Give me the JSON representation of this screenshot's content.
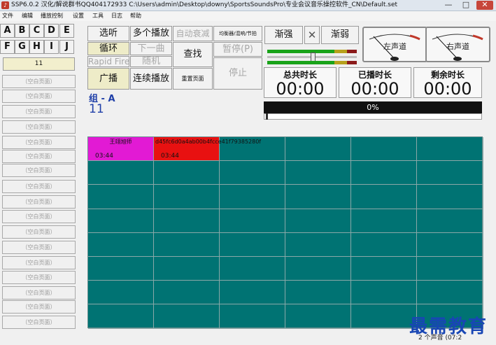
{
  "window": {
    "title": "SSP6.0.2 汉化/解说群书QQ404172933    C:\\Users\\admin\\Desktop\\downy\\SportsSoundsPro\\专业会议音乐操控软件_CN\\Default.set",
    "minimize": "—",
    "maximize": "□",
    "close": "✕"
  },
  "menu": [
    "文件",
    "编辑",
    "播放控制",
    "设置",
    "工具",
    "日志",
    "帮助"
  ],
  "groups": {
    "row1": [
      "A",
      "B",
      "C",
      "D",
      "E"
    ],
    "row2": [
      "F",
      "G",
      "H",
      "I",
      "J"
    ],
    "current_value": "11"
  },
  "empty_page_label": "（空白页面）",
  "controls": {
    "audition": "选听",
    "multi_play": "多个播放",
    "auto_fade": "自动衰减",
    "eq_reverb": "均衡器/混响/节拍",
    "loop": "循环",
    "next_track": "下一曲",
    "search": "查找",
    "pause": "暂停(P)",
    "rapid_fire": "Rapid Fire",
    "random": "随机",
    "broadcast": "广播",
    "continuous_play": "连续播放",
    "reset_page": "重置页面",
    "stop": "停止",
    "fade_in": "渐强",
    "fade_x": "✕",
    "fade_out": "渐弱"
  },
  "meters": {
    "left": "左声道",
    "right": "右声道"
  },
  "group_info": {
    "group_label": "组 - A",
    "page_number": "11"
  },
  "times": {
    "total_label": "总共时长",
    "total_value": "00:00",
    "played_label": "已播时长",
    "played_value": "00:00",
    "remaining_label": "剩余时长",
    "remaining_value": "00:00"
  },
  "progress": {
    "text": "0%",
    "value": 0
  },
  "sound_buttons": [
    {
      "title": "王翊旭师",
      "duration": "03:44",
      "color": "#e21ad4"
    },
    {
      "title": "d45fc6d0a4ab00b4fcce41f79385280f",
      "duration": "03:44",
      "color": "#e81111"
    }
  ],
  "status": "2 个声音 (07:2",
  "watermark": "最需教育"
}
